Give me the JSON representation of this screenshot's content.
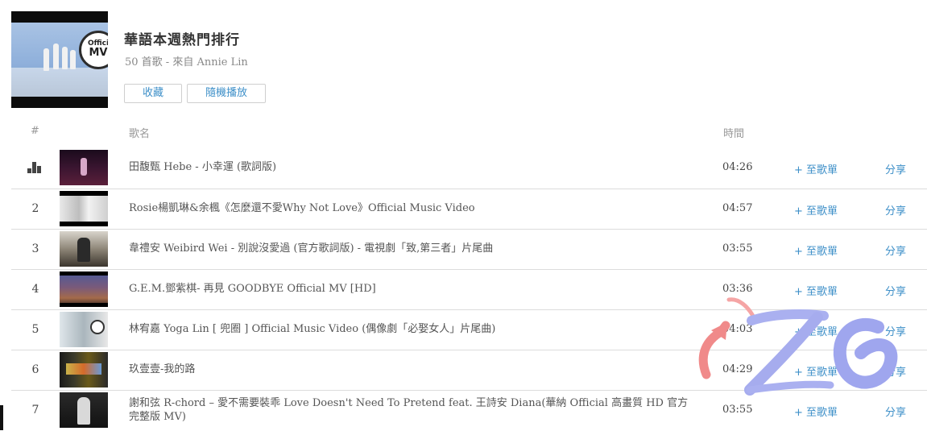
{
  "playlist": {
    "title": "華語本週熱門排行",
    "meta": "50 首歌  -  來自 Annie Lin",
    "cover_badge_line1": "Offici",
    "cover_badge_line2": "MV",
    "favorite_label": "收藏",
    "shuffle_label": "隨機播放"
  },
  "table": {
    "col_num": "#",
    "col_name": "歌名",
    "col_time": "時間"
  },
  "rows": [
    {
      "num": "",
      "playing": true,
      "title": "田馥甄 Hebe - 小幸運 (歌詞版)",
      "duration": "04:26",
      "add": "+ 至歌單",
      "share": "分享"
    },
    {
      "num": "2",
      "playing": false,
      "title": "Rosie楊凱琳&余楓《怎麼還不愛Why Not Love》Official Music Video",
      "duration": "04:57",
      "add": "+ 至歌單",
      "share": "分享"
    },
    {
      "num": "3",
      "playing": false,
      "title": "韋禮安 Weibird Wei - 別說沒愛過 (官方歌詞版) - 電視劇「致,第三者」片尾曲",
      "duration": "03:55",
      "add": "+ 至歌單",
      "share": "分享"
    },
    {
      "num": "4",
      "playing": false,
      "title": "G.E.M.鄧紫棋- 再見 GOODBYE Official MV [HD]",
      "duration": "03:36",
      "add": "+ 至歌單",
      "share": "分享"
    },
    {
      "num": "5",
      "playing": false,
      "title": "林宥嘉 Yoga Lin [ 兜圈 ] Official Music Video (偶像劇「必娶女人」片尾曲)",
      "duration": "04:03",
      "add": "+ 至歌單",
      "share": "分享"
    },
    {
      "num": "6",
      "playing": false,
      "title": "玖壹壹-我的路",
      "duration": "04:29",
      "add": "+ 至歌單",
      "share": "分享"
    },
    {
      "num": "7",
      "playing": false,
      "title": "謝和弦 R-chord – 愛不需要裝乖 Love Doesn't Need To Pretend feat. 王詩安 Diana(華納 Official 高畫質 HD 官方完整版 MV)",
      "duration": "03:55",
      "add": "+ 至歌單",
      "share": "分享"
    }
  ],
  "icons": {
    "now_playing": "bars-icon"
  },
  "colors": {
    "link": "#3d8fc8",
    "text": "#444444",
    "muted": "#999999"
  }
}
